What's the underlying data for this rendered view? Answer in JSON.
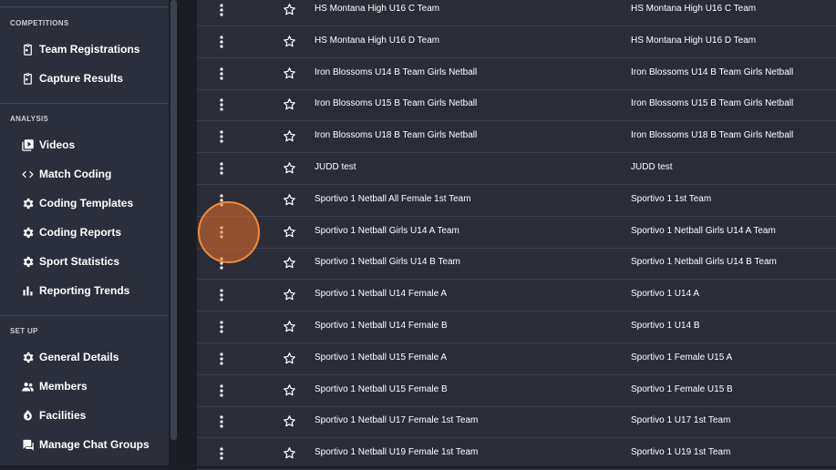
{
  "sidebar": {
    "sections": [
      {
        "label": "COMPETITIONS",
        "items": [
          {
            "label": "Team Registrations",
            "icon": "clipboard-icon"
          },
          {
            "label": "Capture Results",
            "icon": "clipboard-icon"
          }
        ]
      },
      {
        "label": "ANALYSIS",
        "items": [
          {
            "label": "Videos",
            "icon": "video-icon"
          },
          {
            "label": "Match Coding",
            "icon": "code-icon"
          },
          {
            "label": "Coding Templates",
            "icon": "gear-icon"
          },
          {
            "label": "Coding Reports",
            "icon": "gear-icon"
          },
          {
            "label": "Sport Statistics",
            "icon": "gear-icon"
          },
          {
            "label": "Reporting Trends",
            "icon": "bar-chart-icon"
          }
        ]
      },
      {
        "label": "SET UP",
        "items": [
          {
            "label": "General Details",
            "icon": "gear-icon"
          },
          {
            "label": "Members",
            "icon": "people-icon"
          },
          {
            "label": "Facilities",
            "icon": "facility-icon"
          },
          {
            "label": "Manage Chat Groups",
            "icon": "chat-icon"
          }
        ]
      }
    ]
  },
  "teams": {
    "rows": [
      {
        "name": "HS Montana High U16 C Team",
        "short_name": "HS Montana High U16 C Team"
      },
      {
        "name": "HS Montana High U16 D Team",
        "short_name": "HS Montana High U16 D Team"
      },
      {
        "name": "Iron Blossoms U14 B Team Girls Netball",
        "short_name": "Iron Blossoms U14 B Team Girls Netball"
      },
      {
        "name": "Iron Blossoms U15 B Team Girls Netball",
        "short_name": "Iron Blossoms U15 B Team Girls Netball"
      },
      {
        "name": "Iron Blossoms U18 B Team Girls Netball",
        "short_name": "Iron Blossoms U18 B Team Girls Netball"
      },
      {
        "name": "JUDD test",
        "short_name": "JUDD test"
      },
      {
        "name": "Sportivo 1 Netball All Female 1st Team",
        "short_name": "Sportivo 1 1st Team"
      },
      {
        "name": "Sportivo 1 Netball Girls U14 A Team",
        "short_name": "Sportivo 1 Netball Girls U14 A Team"
      },
      {
        "name": "Sportivo 1 Netball Girls U14 B Team",
        "short_name": "Sportivo 1 Netball Girls U14 B Team"
      },
      {
        "name": "Sportivo 1 Netball U14 Female A",
        "short_name": "Sportivo 1 U14 A"
      },
      {
        "name": "Sportivo 1 Netball U14 Female B",
        "short_name": "Sportivo 1 U14 B"
      },
      {
        "name": "Sportivo 1 Netball U15 Female A",
        "short_name": "Sportivo 1 Female U15 A"
      },
      {
        "name": "Sportivo 1 Netball U15 Female B",
        "short_name": "Sportivo 1 Female U15 B"
      },
      {
        "name": "Sportivo 1 Netball U17 Female 1st Team",
        "short_name": "Sportivo 1 U17 1st Team"
      },
      {
        "name": "Sportivo 1 Netball U19 Female 1st Team",
        "short_name": "Sportivo 1 U19 1st Team"
      }
    ]
  },
  "colors": {
    "sidebar_bg": "#2b2f3b",
    "main_bg": "#2a2d38",
    "click_marker": "#f08a3c"
  }
}
